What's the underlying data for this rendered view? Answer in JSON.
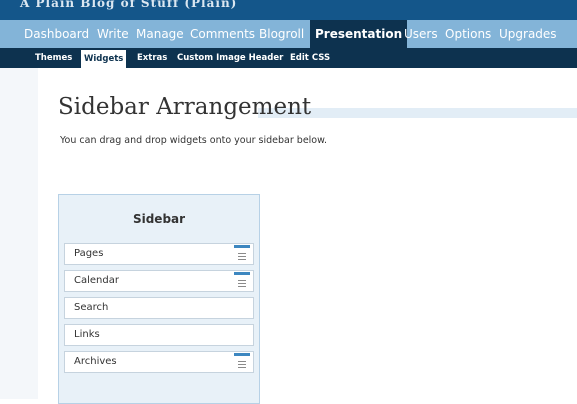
{
  "header": {
    "site_title": "A Plain Blog of Stuff (Plain)"
  },
  "main_nav": {
    "items": [
      {
        "label": "Dashboard"
      },
      {
        "label": "Write"
      },
      {
        "label": "Manage"
      },
      {
        "label": "Comments"
      },
      {
        "label": "Blogroll"
      },
      {
        "label": "Presentation",
        "active": true
      },
      {
        "label": "Users"
      },
      {
        "label": "Options"
      },
      {
        "label": "Upgrades"
      }
    ]
  },
  "sub_nav": {
    "items": [
      {
        "label": "Themes"
      },
      {
        "label": "Widgets",
        "active": true
      },
      {
        "label": "Extras"
      },
      {
        "label": "Custom Image Header"
      },
      {
        "label": "Edit CSS"
      }
    ]
  },
  "page": {
    "title": "Sidebar Arrangement",
    "intro": "You can drag and drop widgets onto your sidebar below."
  },
  "sidebar": {
    "heading": "Sidebar",
    "widgets": [
      {
        "label": "Pages",
        "has_controls": true
      },
      {
        "label": "Calendar",
        "has_controls": true
      },
      {
        "label": "Search",
        "has_controls": false
      },
      {
        "label": "Links",
        "has_controls": false
      },
      {
        "label": "Archives",
        "has_controls": true
      }
    ]
  },
  "colors": {
    "topbar": "#14568a",
    "main_nav": "#83b4d8",
    "sub_nav": "#0d324f",
    "sidebar_panel": "#e8f1f8",
    "control_accent": "#3d87c0"
  },
  "icons": {
    "widget_control": "widget-options-icon"
  }
}
